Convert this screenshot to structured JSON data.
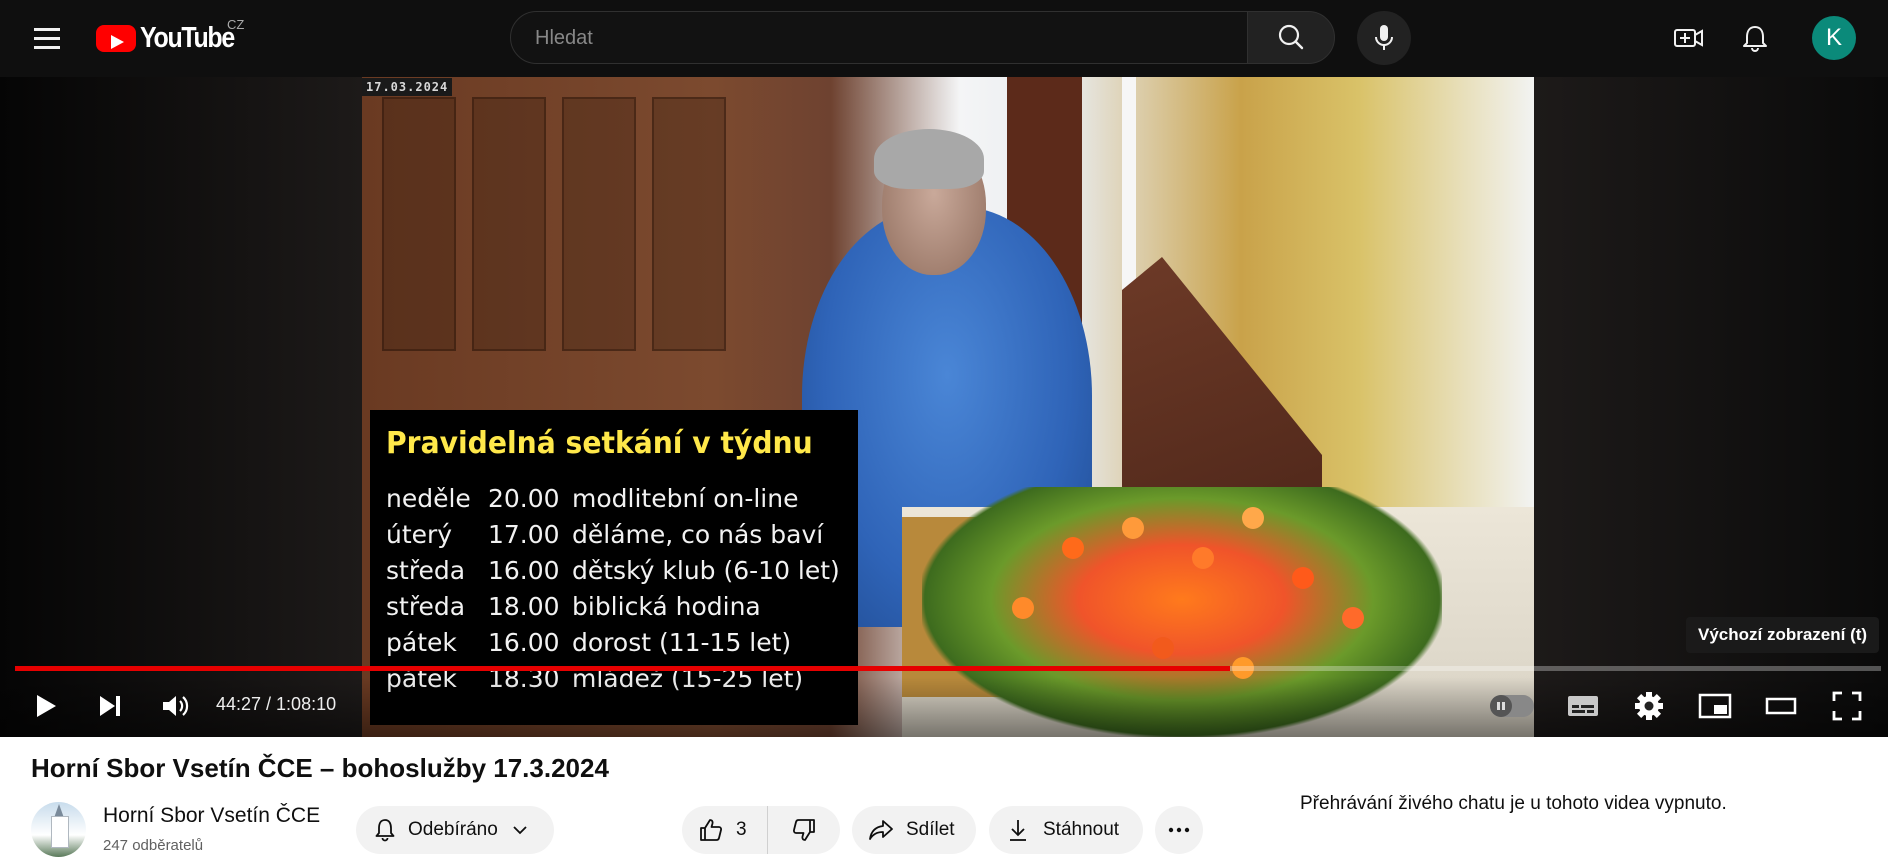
{
  "header": {
    "logo_text": "YouTube",
    "country_code": "CZ",
    "search_placeholder": "Hledat",
    "avatar_letter": "K",
    "icons": [
      "menu-icon",
      "search-icon",
      "mic-icon",
      "create-video-icon",
      "bell-icon"
    ]
  },
  "player": {
    "video_date_stamp": "17.03.2024",
    "overlay_title": "Pravidelná setkání v týdnu",
    "schedule": [
      {
        "day": "neděle",
        "time": "20.00",
        "activity": "modlitební on-line"
      },
      {
        "day": "úterý",
        "time": "17.00",
        "activity": "děláme, co nás baví"
      },
      {
        "day": "středa",
        "time": "16.00",
        "activity": "dětský klub (6-10 let)"
      },
      {
        "day": "středa",
        "time": "18.00",
        "activity": "biblická hodina"
      },
      {
        "day": "pátek",
        "time": "16.00",
        "activity": "dorost (11-15 let)"
      },
      {
        "day": "pátek",
        "time": "18.30",
        "activity": "mládež (15-25 let)"
      }
    ],
    "tooltip": "Výchozí zobrazení (t)",
    "time_display": "44:27 / 1:08:10",
    "progress_fraction": 0.651,
    "accent_color": "#e60000",
    "controls": [
      "play-icon",
      "next-icon",
      "volume-icon",
      "autoplay-toggle",
      "subtitles-icon",
      "settings-icon",
      "miniplayer-icon",
      "theater-icon",
      "fullscreen-icon"
    ]
  },
  "video": {
    "title": "Horní Sbor Vsetín ČCE – bohoslužby 17.3.2024",
    "channel_name": "Horní Sbor Vsetín ČCE",
    "subscribers": "247 odběratelů",
    "subscribe_label": "Odebíráno",
    "like_count": "3",
    "share_label": "Sdílet",
    "download_label": "Stáhnout",
    "live_chat_notice": "Přehrávání živého chatu je u tohoto videa vypnuto."
  }
}
